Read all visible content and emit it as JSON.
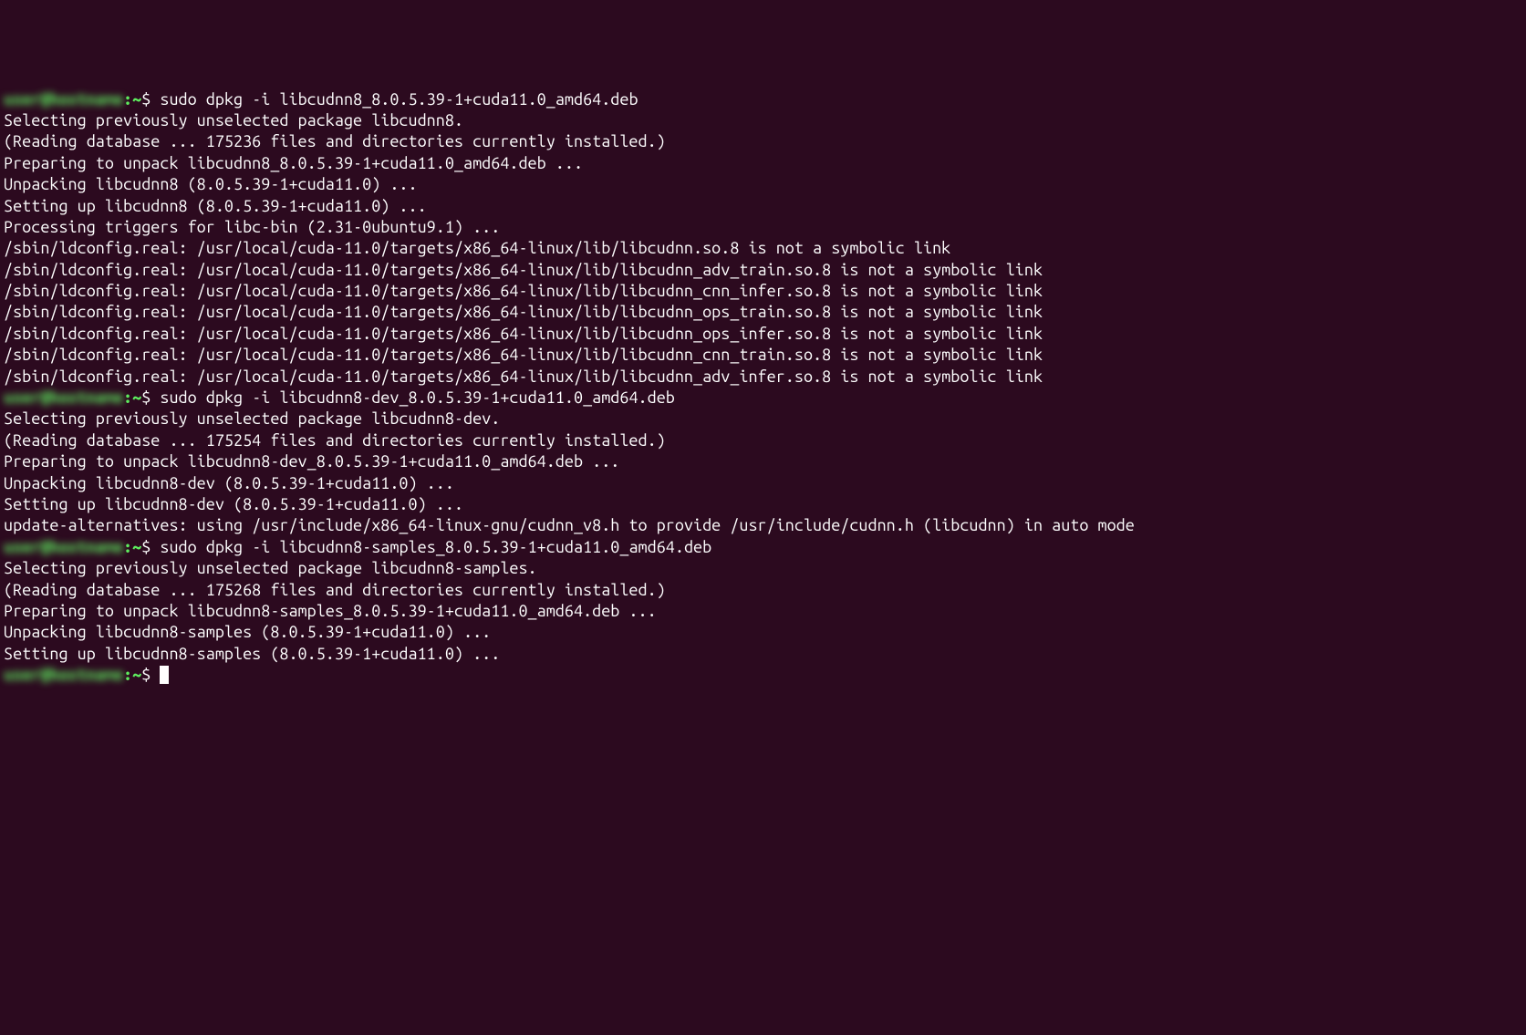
{
  "prompts": [
    {
      "host": "user@hostname",
      "path": ":~",
      "symbol": "$ ",
      "command": "sudo dpkg -i libcudnn8_8.0.5.39-1+cuda11.0_amd64.deb"
    },
    {
      "host": "user@hostname",
      "path": ":~",
      "symbol": "$ ",
      "command": "sudo dpkg -i libcudnn8-dev_8.0.5.39-1+cuda11.0_amd64.deb"
    },
    {
      "host": "user@hostname",
      "path": ":~",
      "symbol": "$ ",
      "command": "sudo dpkg -i libcudnn8-samples_8.0.5.39-1+cuda11.0_amd64.deb"
    },
    {
      "host": "user@hostname",
      "path": ":~",
      "symbol": "$ ",
      "command": ""
    }
  ],
  "output_block_1": [
    "Selecting previously unselected package libcudnn8.",
    "(Reading database ... 175236 files and directories currently installed.)",
    "Preparing to unpack libcudnn8_8.0.5.39-1+cuda11.0_amd64.deb ...",
    "Unpacking libcudnn8 (8.0.5.39-1+cuda11.0) ...",
    "Setting up libcudnn8 (8.0.5.39-1+cuda11.0) ...",
    "Processing triggers for libc-bin (2.31-0ubuntu9.1) ...",
    "/sbin/ldconfig.real: /usr/local/cuda-11.0/targets/x86_64-linux/lib/libcudnn.so.8 is not a symbolic link",
    "",
    "/sbin/ldconfig.real: /usr/local/cuda-11.0/targets/x86_64-linux/lib/libcudnn_adv_train.so.8 is not a symbolic link",
    "",
    "/sbin/ldconfig.real: /usr/local/cuda-11.0/targets/x86_64-linux/lib/libcudnn_cnn_infer.so.8 is not a symbolic link",
    "",
    "/sbin/ldconfig.real: /usr/local/cuda-11.0/targets/x86_64-linux/lib/libcudnn_ops_train.so.8 is not a symbolic link",
    "",
    "/sbin/ldconfig.real: /usr/local/cuda-11.0/targets/x86_64-linux/lib/libcudnn_ops_infer.so.8 is not a symbolic link",
    "",
    "/sbin/ldconfig.real: /usr/local/cuda-11.0/targets/x86_64-linux/lib/libcudnn_cnn_train.so.8 is not a symbolic link",
    "",
    "/sbin/ldconfig.real: /usr/local/cuda-11.0/targets/x86_64-linux/lib/libcudnn_adv_infer.so.8 is not a symbolic link",
    ""
  ],
  "output_block_2": [
    "Selecting previously unselected package libcudnn8-dev.",
    "(Reading database ... 175254 files and directories currently installed.)",
    "Preparing to unpack libcudnn8-dev_8.0.5.39-1+cuda11.0_amd64.deb ...",
    "Unpacking libcudnn8-dev (8.0.5.39-1+cuda11.0) ...",
    "Setting up libcudnn8-dev (8.0.5.39-1+cuda11.0) ...",
    "update-alternatives: using /usr/include/x86_64-linux-gnu/cudnn_v8.h to provide /usr/include/cudnn.h (libcudnn) in auto mode"
  ],
  "output_block_3": [
    "Selecting previously unselected package libcudnn8-samples.",
    "(Reading database ... 175268 files and directories currently installed.)",
    "Preparing to unpack libcudnn8-samples_8.0.5.39-1+cuda11.0_amd64.deb ...",
    "Unpacking libcudnn8-samples (8.0.5.39-1+cuda11.0) ...",
    "Setting up libcudnn8-samples (8.0.5.39-1+cuda11.0) ..."
  ]
}
